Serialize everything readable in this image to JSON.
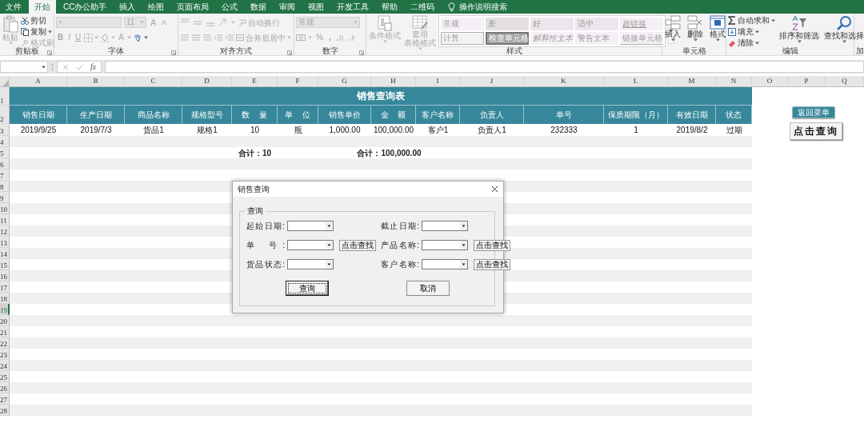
{
  "menu_tabs": [
    {
      "label": "文件",
      "selected": false
    },
    {
      "label": "开始",
      "selected": true
    },
    {
      "label": "CC办公助手",
      "selected": false
    },
    {
      "label": "插入",
      "selected": false
    },
    {
      "label": "绘图",
      "selected": false
    },
    {
      "label": "页面布局",
      "selected": false
    },
    {
      "label": "公式",
      "selected": false
    },
    {
      "label": "数据",
      "selected": false
    },
    {
      "label": "审阅",
      "selected": false
    },
    {
      "label": "视图",
      "selected": false
    },
    {
      "label": "开发工具",
      "selected": false
    },
    {
      "label": "帮助",
      "selected": false
    },
    {
      "label": "二维码",
      "selected": false
    }
  ],
  "tell_me": "操作说明搜索",
  "ribbon": [
    {
      "kind": "clipboard",
      "label": "剪贴板",
      "paste": {
        "text": "粘贴",
        "disabled": true
      },
      "cut": {
        "text": "剪切",
        "disabled": false
      },
      "copy": {
        "text": "复制",
        "disabled": false
      },
      "painter": {
        "text": "格式刷",
        "disabled": true
      }
    },
    {
      "kind": "font",
      "label": "字体",
      "disabled": true,
      "font_size": "11",
      "grow": "A",
      "shrink": "A",
      "bold": "B",
      "italic": "I",
      "underline": "U",
      "font_color": "A"
    },
    {
      "kind": "alignment",
      "label": "对齐方式",
      "disabled": true,
      "wrap": "自动换行",
      "merge": "合并后居中"
    },
    {
      "kind": "number",
      "label": "数字",
      "disabled": true,
      "format": "常规",
      "percent": "%",
      "comma": ","
    },
    {
      "kind": "styles",
      "label": "样式",
      "disabled": true,
      "conditional": [
        "条件格式"
      ],
      "table": [
        "套用",
        "表格格式"
      ],
      "styles": [
        {
          "text": "常规",
          "kind": "normal"
        },
        {
          "text": "差",
          "kind": "bad"
        },
        {
          "text": "好",
          "kind": "good"
        },
        {
          "text": "适中",
          "kind": "neutral"
        },
        {
          "text": "超链接",
          "kind": "hyperlink"
        },
        {
          "text": "计算",
          "kind": "calculation"
        },
        {
          "text": "检查单元格",
          "kind": "check"
        },
        {
          "text": "解释性文本",
          "kind": "explanatory"
        },
        {
          "text": "警告文本",
          "kind": "warning"
        },
        {
          "text": "链接单元格",
          "kind": "linked"
        }
      ]
    },
    {
      "kind": "cells",
      "label": "单元格",
      "insert": "插入",
      "delete": "删除",
      "format": "格式"
    },
    {
      "kind": "editing",
      "label": "编辑",
      "autosum": "自动求和",
      "fill": "填充",
      "clear": "清除",
      "sort": "排序和筛选",
      "find": "查找和选择"
    },
    {
      "kind": "partial",
      "label": "加"
    }
  ],
  "formula_bar": {
    "function_label": "fx"
  },
  "sheet": {
    "columns": [
      "A",
      "B",
      "C",
      "D",
      "E",
      "F",
      "G",
      "H",
      "I",
      "J",
      "K",
      "L",
      "M",
      "N",
      "O",
      "P",
      "Q"
    ],
    "rows": [
      {
        "label": "1",
        "selected": false
      },
      {
        "label": "2",
        "selected": false
      },
      {
        "label": "3",
        "selected": false
      },
      {
        "label": "4",
        "selected": false
      },
      {
        "label": "5",
        "selected": false
      },
      {
        "label": "6",
        "selected": false
      },
      {
        "label": "7",
        "selected": false
      },
      {
        "label": "8",
        "selected": false
      },
      {
        "label": "9",
        "selected": false
      },
      {
        "label": "10",
        "selected": false
      },
      {
        "label": "11",
        "selected": false
      },
      {
        "label": "12",
        "selected": false
      },
      {
        "label": "13",
        "selected": false
      },
      {
        "label": "14",
        "selected": false
      },
      {
        "label": "15",
        "selected": false
      },
      {
        "label": "16",
        "selected": false
      },
      {
        "label": "17",
        "selected": false
      },
      {
        "label": "18",
        "selected": false
      },
      {
        "label": "19",
        "selected": true
      },
      {
        "label": "20",
        "selected": false
      },
      {
        "label": "21",
        "selected": false
      },
      {
        "label": "22",
        "selected": false
      },
      {
        "label": "23",
        "selected": false
      },
      {
        "label": "24",
        "selected": false
      },
      {
        "label": "25",
        "selected": false
      },
      {
        "label": "26",
        "selected": false
      },
      {
        "label": "27",
        "selected": false
      },
      {
        "label": "28",
        "selected": false
      }
    ],
    "title": "销售查询表",
    "headers": [
      "销售日期",
      "生产日期",
      "商品名称",
      "规格型号",
      "数    量",
      "单    位",
      "销售单价",
      "金    额",
      "客户名称",
      "负责人",
      "单号",
      "保质期限（月）",
      "有效日期",
      "状态"
    ],
    "records": [
      [
        "2019/9/25",
        "2019/7/3",
        "货品1",
        "规格1",
        "10",
        "瓶",
        "1,000.00",
        "100,000.00",
        "客户1",
        "负责人1",
        "232333",
        "1",
        "2019/8/2",
        "过期"
      ]
    ],
    "totals": [
      "合计：10",
      "合计：100,000.00"
    ]
  },
  "sheet_buttons": [
    {
      "text": "返回菜单",
      "kind": "flat"
    },
    {
      "text": "点击查询",
      "kind": "raised"
    }
  ],
  "dialog": {
    "title": "销售查询",
    "group": "查询",
    "fields": [
      {
        "label": "起始日期:"
      },
      {
        "label": "截止日期:"
      },
      {
        "label": "单 号:",
        "find": "点击查找"
      },
      {
        "label": "产品名称:",
        "find": "点击查找"
      },
      {
        "label": "货品状态:"
      },
      {
        "label": "客户名称:",
        "find": "点击查找"
      }
    ],
    "buttons": [
      {
        "text": "查询",
        "focused": true
      },
      {
        "text": "取消",
        "focused": false
      }
    ]
  }
}
